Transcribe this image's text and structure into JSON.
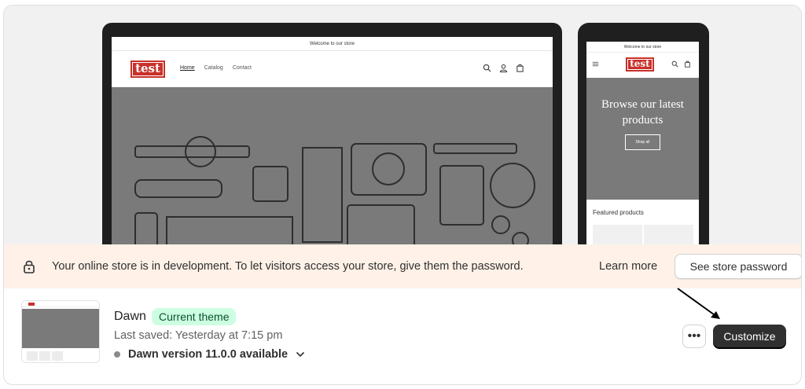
{
  "preview": {
    "desktop": {
      "announcement": "Welcome to our store",
      "logo_text": "test",
      "nav": [
        "Home",
        "Catalog",
        "Contact"
      ],
      "icons": [
        "search-icon",
        "account-icon",
        "cart-icon"
      ]
    },
    "mobile": {
      "announcement": "Welcome to our store",
      "logo_text": "test",
      "hero_title": "Browse our latest products",
      "hero_button": "Shop all",
      "featured_heading": "Featured products",
      "icons": [
        "menu-icon",
        "search-icon",
        "cart-icon"
      ]
    }
  },
  "banner": {
    "icon": "lock-icon",
    "message": "Your online store is in development. To let visitors access your store, give them the password.",
    "learn_more": "Learn more",
    "password_button": "See store password"
  },
  "theme": {
    "name": "Dawn",
    "badge": "Current theme",
    "last_saved": "Last saved: Yesterday at 7:15 pm",
    "version_text": "Dawn version 11.0.0 available",
    "more_button": "•••",
    "customize_button": "Customize"
  },
  "colors": {
    "banner_bg": "#fff1e7",
    "badge_bg": "#cdfee1",
    "badge_text": "#0c5132",
    "primary_button": "#303030",
    "logo_red": "#c8312a"
  }
}
